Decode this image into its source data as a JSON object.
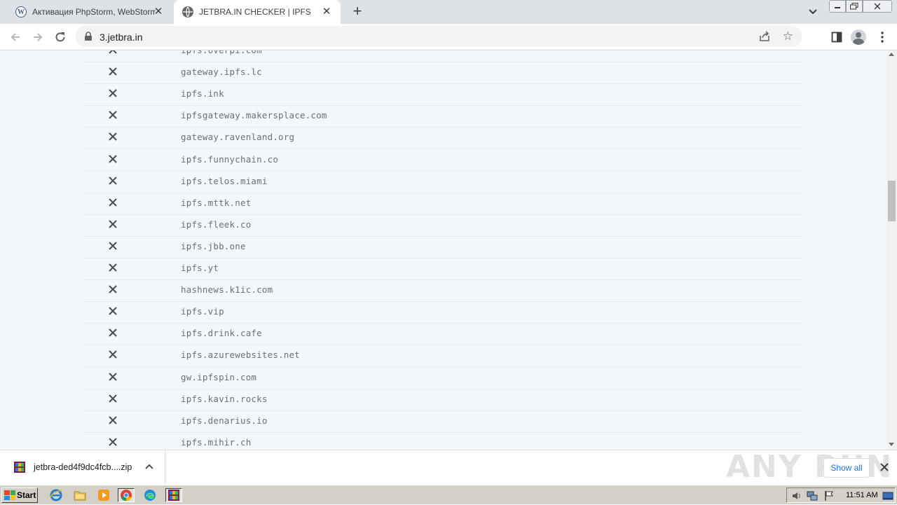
{
  "browser": {
    "tabs": [
      {
        "title": "Активация PhpStorm, WebStorm, Ii",
        "favicon": "wordpress-icon",
        "active": false
      },
      {
        "title": "JETBRA.IN CHECKER | IPFS",
        "favicon": "globe-icon",
        "active": true
      }
    ],
    "url": "3.jetbra.in"
  },
  "gateways": [
    "ipfs.overpi.com",
    "gateway.ipfs.lc",
    "ipfs.ink",
    "ipfsgateway.makersplace.com",
    "gateway.ravenland.org",
    "ipfs.funnychain.co",
    "ipfs.telos.miami",
    "ipfs.mttk.net",
    "ipfs.fleek.co",
    "ipfs.jbb.one",
    "ipfs.yt",
    "hashnews.k1ic.com",
    "ipfs.vip",
    "ipfs.drink.cafe",
    "ipfs.azurewebsites.net",
    "gw.ipfspin.com",
    "ipfs.kavin.rocks",
    "ipfs.denarius.io",
    "ipfs.mihir.ch"
  ],
  "downloads": {
    "filename": "jetbra-ded4f9dc4fcb....zip",
    "show_all_label": "Show all"
  },
  "watermark": "ANY RUN",
  "taskbar": {
    "start_label": "Start",
    "clock": "11:51 AM"
  }
}
